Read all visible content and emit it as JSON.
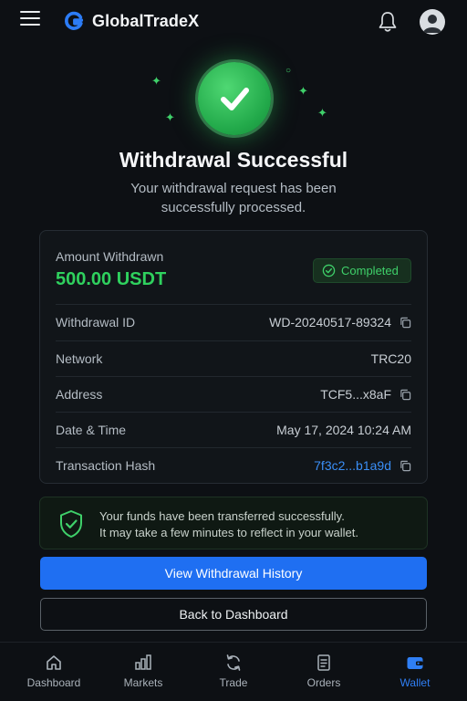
{
  "header": {
    "brand": "GlobalTradeX",
    "icons": [
      "menu-icon",
      "logo-icon",
      "bell-icon",
      "user-avatar-icon"
    ]
  },
  "hero": {
    "title": "Withdrawal Successful",
    "subtitle": "Your withdrawal request has been successfully processed.",
    "icon": "checkmark-icon"
  },
  "summary": {
    "amount_label": "Amount Withdrawn",
    "amount_value": "500.00 USDT",
    "status": "Completed",
    "rows": [
      {
        "label": "Withdrawal ID",
        "value": "WD-20240517-89324",
        "copy": true
      },
      {
        "label": "Network",
        "value": "TRC20",
        "copy": false
      },
      {
        "label": "Address",
        "value": "TCF5...x8aF",
        "copy": true
      },
      {
        "label": "Date & Time",
        "value": "May 17, 2024 10:24 AM",
        "copy": false
      },
      {
        "label": "Transaction Hash",
        "value": "7f3c2...b1a9d",
        "copy": true
      }
    ]
  },
  "notice": {
    "line1": "Your funds have been transferred successfully.",
    "line2": "It may take a few minutes to reflect in your wallet.",
    "icon": "shield-check-icon"
  },
  "actions": {
    "primary": "View Withdrawal History",
    "secondary": "Back to Dashboard"
  },
  "nav": {
    "items": [
      {
        "label": "Dashboard",
        "icon": "home-icon"
      },
      {
        "label": "Markets",
        "icon": "bar-chart-icon"
      },
      {
        "label": "Trade",
        "icon": "refresh-icon"
      },
      {
        "label": "Orders",
        "icon": "document-icon"
      },
      {
        "label": "Wallet",
        "icon": "wallet-icon"
      }
    ],
    "active": "Wallet"
  },
  "colors": {
    "background": "#0d1014",
    "success": "#2fd15e",
    "accent": "#1f6ff2",
    "link": "#3a8ef6"
  }
}
